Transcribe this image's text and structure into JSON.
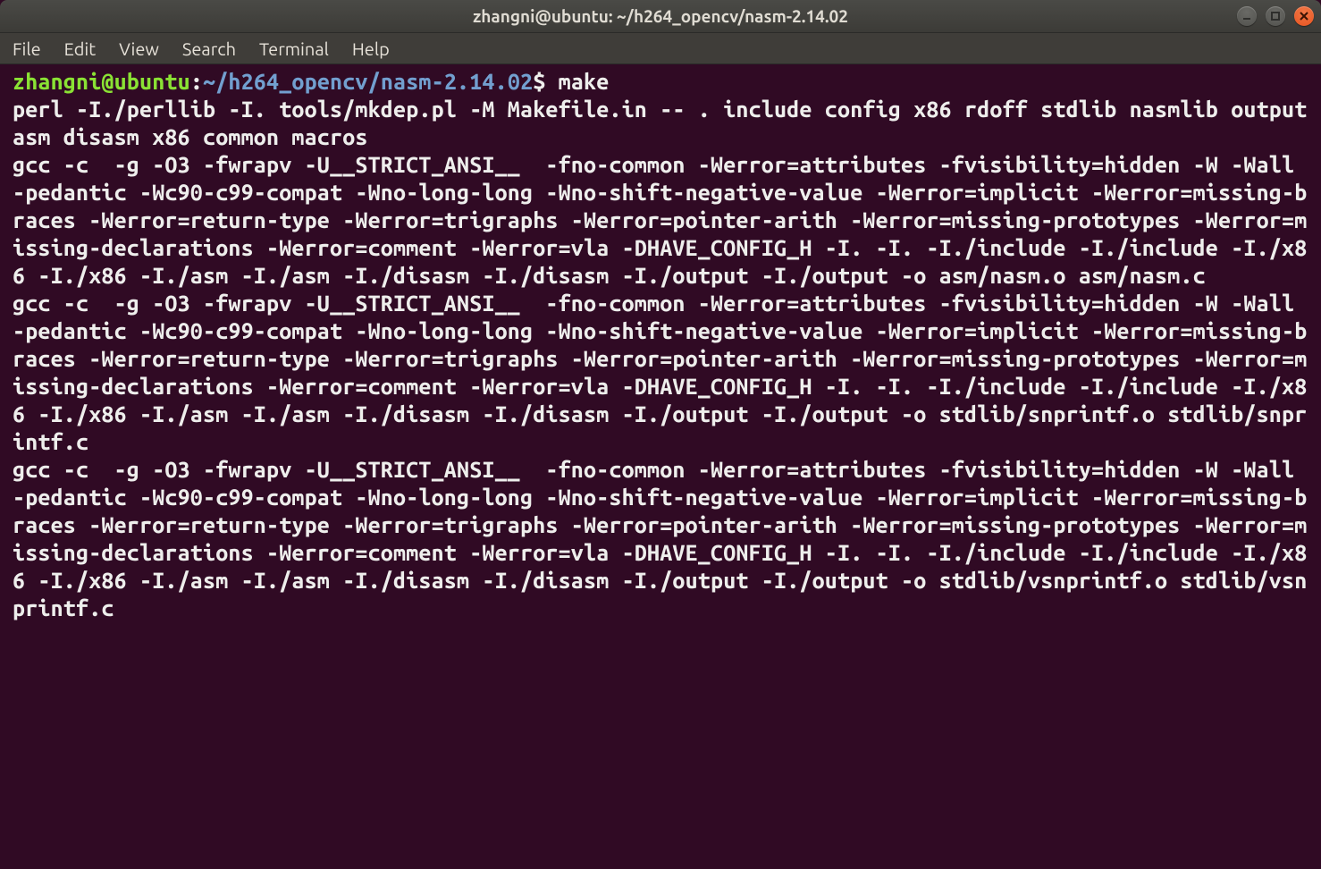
{
  "window": {
    "title": "zhangni@ubuntu: ~/h264_opencv/nasm-2.14.02"
  },
  "menu": {
    "items": [
      "File",
      "Edit",
      "View",
      "Search",
      "Terminal",
      "Help"
    ]
  },
  "prompt": {
    "user_host": "zhangni@ubuntu",
    "separator": ":",
    "path": "~/h264_opencv/nasm-2.14.02",
    "symbol": "$",
    "command": "make"
  },
  "output_lines": [
    "perl -I./perllib -I. tools/mkdep.pl -M Makefile.in -- . include config x86 rdoff stdlib nasmlib output asm disasm x86 common macros",
    "gcc -c  -g -O3 -fwrapv -U__STRICT_ANSI__  -fno-common -Werror=attributes -fvisibility=hidden -W -Wall -pedantic -Wc90-c99-compat -Wno-long-long -Wno-shift-negative-value -Werror=implicit -Werror=missing-braces -Werror=return-type -Werror=trigraphs -Werror=pointer-arith -Werror=missing-prototypes -Werror=missing-declarations -Werror=comment -Werror=vla -DHAVE_CONFIG_H -I. -I. -I./include -I./include -I./x86 -I./x86 -I./asm -I./asm -I./disasm -I./disasm -I./output -I./output -o asm/nasm.o asm/nasm.c",
    "gcc -c  -g -O3 -fwrapv -U__STRICT_ANSI__  -fno-common -Werror=attributes -fvisibility=hidden -W -Wall -pedantic -Wc90-c99-compat -Wno-long-long -Wno-shift-negative-value -Werror=implicit -Werror=missing-braces -Werror=return-type -Werror=trigraphs -Werror=pointer-arith -Werror=missing-prototypes -Werror=missing-declarations -Werror=comment -Werror=vla -DHAVE_CONFIG_H -I. -I. -I./include -I./include -I./x86 -I./x86 -I./asm -I./asm -I./disasm -I./disasm -I./output -I./output -o stdlib/snprintf.o stdlib/snprintf.c",
    "gcc -c  -g -O3 -fwrapv -U__STRICT_ANSI__  -fno-common -Werror=attributes -fvisibility=hidden -W -Wall -pedantic -Wc90-c99-compat -Wno-long-long -Wno-shift-negative-value -Werror=implicit -Werror=missing-braces -Werror=return-type -Werror=trigraphs -Werror=pointer-arith -Werror=missing-prototypes -Werror=missing-declarations -Werror=comment -Werror=vla -DHAVE_CONFIG_H -I. -I. -I./include -I./include -I./x86 -I./x86 -I./asm -I./asm -I./disasm -I./disasm -I./output -I./output -o stdlib/vsnprintf.o stdlib/vsnprintf.c"
  ]
}
